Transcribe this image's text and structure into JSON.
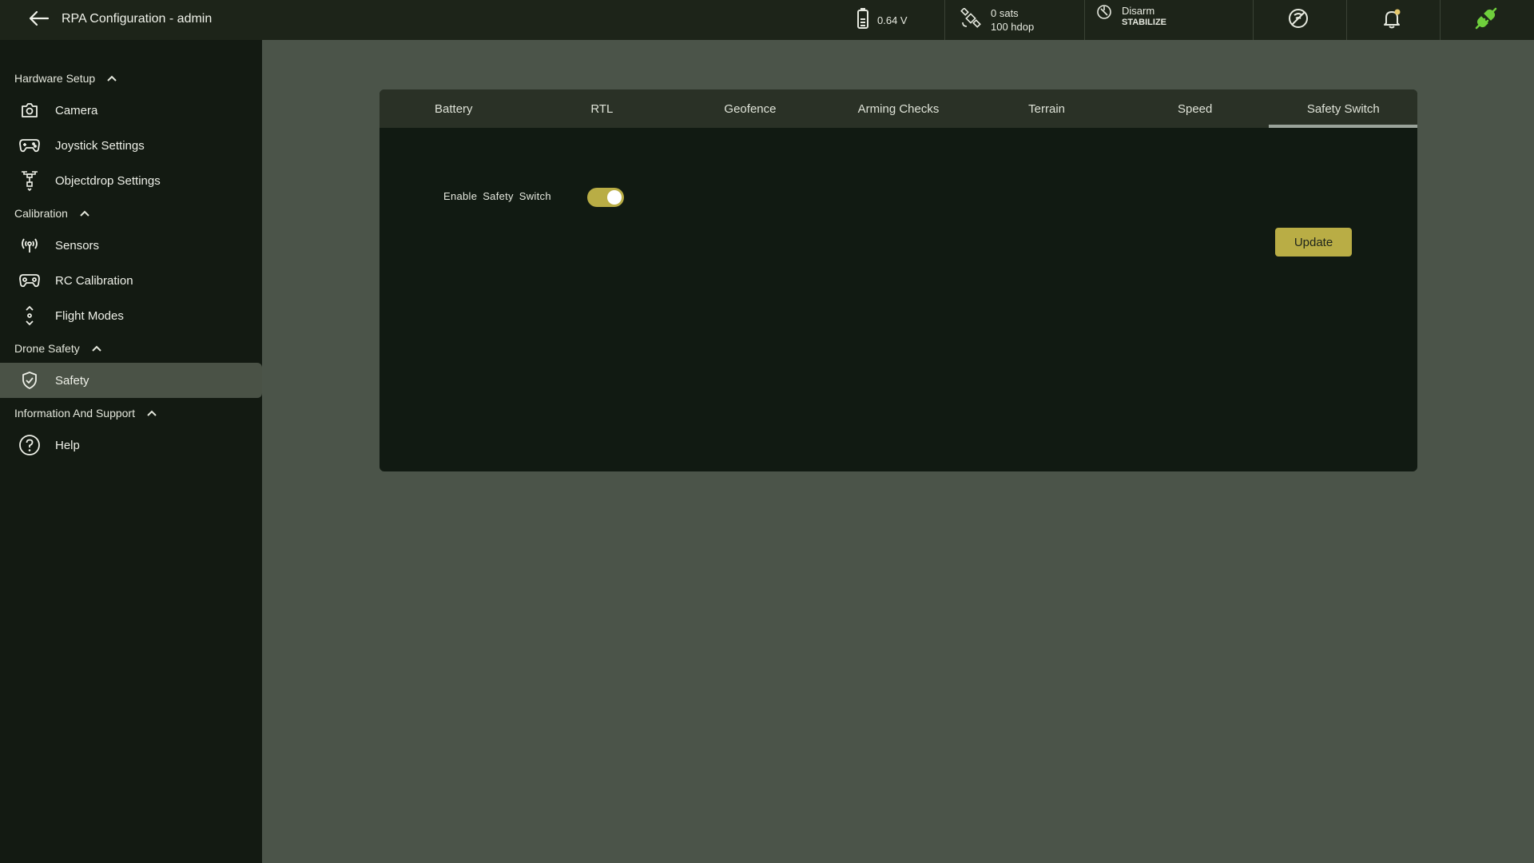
{
  "header": {
    "title": "RPA Configuration - admin",
    "back_icon": "arrow-left-icon",
    "battery": {
      "icon": "battery-icon",
      "value": "0.64 V"
    },
    "gps": {
      "icon": "satellite-icon",
      "sats": "0 sats",
      "hdop": "100 hdop"
    },
    "arm": {
      "icon": "arm-status-icon",
      "status": "Disarm",
      "mode": "STABILIZE"
    },
    "icons": [
      "no-signal-icon",
      "notification-bell-icon",
      "connection-plug-icon"
    ]
  },
  "sidebar": {
    "sections": [
      {
        "label": "Hardware Setup",
        "items": [
          {
            "label": "Camera",
            "icon": "camera-icon"
          },
          {
            "label": "Joystick Settings",
            "icon": "gamepad-icon"
          },
          {
            "label": "Objectdrop Settings",
            "icon": "drone-drop-icon"
          }
        ]
      },
      {
        "label": "Calibration",
        "items": [
          {
            "label": "Sensors",
            "icon": "sensor-signal-icon"
          },
          {
            "label": "RC Calibration",
            "icon": "rc-controller-icon"
          },
          {
            "label": "Flight Modes",
            "icon": "flight-modes-icon"
          }
        ]
      },
      {
        "label": "Drone Safety",
        "items": [
          {
            "label": "Safety",
            "icon": "shield-check-icon",
            "active": true
          }
        ]
      },
      {
        "label": "Information And Support",
        "items": [
          {
            "label": "Help",
            "icon": "help-circle-icon"
          }
        ]
      }
    ]
  },
  "tabs": [
    {
      "label": "Battery"
    },
    {
      "label": "RTL"
    },
    {
      "label": "Geofence"
    },
    {
      "label": "Arming Checks"
    },
    {
      "label": "Terrain"
    },
    {
      "label": "Speed"
    },
    {
      "label": "Safety Switch",
      "active": true
    }
  ],
  "form": {
    "enable_safety_switch_label": "Enable Safety Switch",
    "enable_safety_switch_value": true,
    "update_label": "Update"
  },
  "colors": {
    "accent": "#b9ad45",
    "topbar_bg": "#1d2419",
    "sidebar_bg": "#131a12",
    "page_bg": "#4b5449",
    "card_bg": "#111a12",
    "connected_green": "#6fcf3c"
  }
}
